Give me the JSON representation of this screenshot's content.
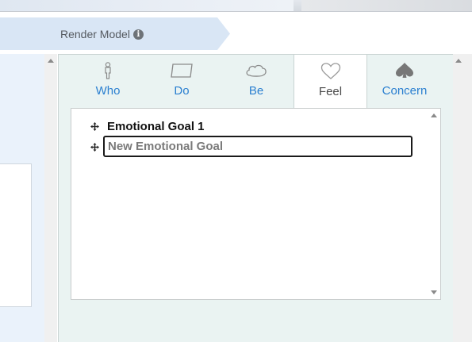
{
  "header": {
    "render_model_label": "Render Model",
    "info_icon": "info-icon"
  },
  "tabs": [
    {
      "label": "Who",
      "icon": "person-icon",
      "active": false
    },
    {
      "label": "Do",
      "icon": "parallelogram-icon",
      "active": false
    },
    {
      "label": "Be",
      "icon": "cloud-icon",
      "active": false
    },
    {
      "label": "Feel",
      "icon": "heart-icon",
      "active": true
    },
    {
      "label": "Concern",
      "icon": "spade-icon",
      "active": false
    }
  ],
  "goals": {
    "items": [
      {
        "label": "Emotional Goal 1",
        "icon": "move-icon"
      }
    ],
    "new_goal_placeholder": "New Emotional Goal",
    "new_goal_value": ""
  },
  "colors": {
    "tab_label": "#2a7fd0",
    "active_tab_label": "#4a4a4a",
    "panel_bg": "#eaf3f2",
    "breadcrumb_bg": "#d9e6f5"
  }
}
